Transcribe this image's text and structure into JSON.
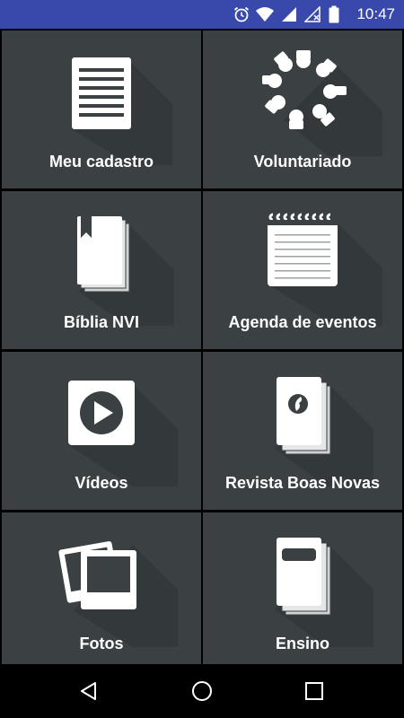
{
  "status_bar": {
    "time": "10:47",
    "icons": [
      "alarm-icon",
      "wifi-icon",
      "cell-signal-icon",
      "no-sim-signal-icon",
      "battery-icon"
    ]
  },
  "menu": {
    "tiles": [
      {
        "label": "Meu cadastro",
        "icon": "document-icon"
      },
      {
        "label": "Voluntariado",
        "icon": "hands-circle-icon"
      },
      {
        "label": "Bíblia NVI",
        "icon": "bible-book-icon"
      },
      {
        "label": "Agenda de eventos",
        "icon": "notepad-icon"
      },
      {
        "label": "Vídeos",
        "icon": "play-icon"
      },
      {
        "label": "Revista Boas Novas",
        "icon": "magazine-icon"
      },
      {
        "label": "Fotos",
        "icon": "photos-icon"
      },
      {
        "label": "Ensino",
        "icon": "notebook-icon"
      }
    ]
  },
  "nav_bar": {
    "buttons": [
      "back-button",
      "home-button",
      "recents-button"
    ]
  },
  "colors": {
    "status_bar": "#3949ab",
    "tile_background": "#3b4042",
    "grid_lines": "#000000"
  }
}
